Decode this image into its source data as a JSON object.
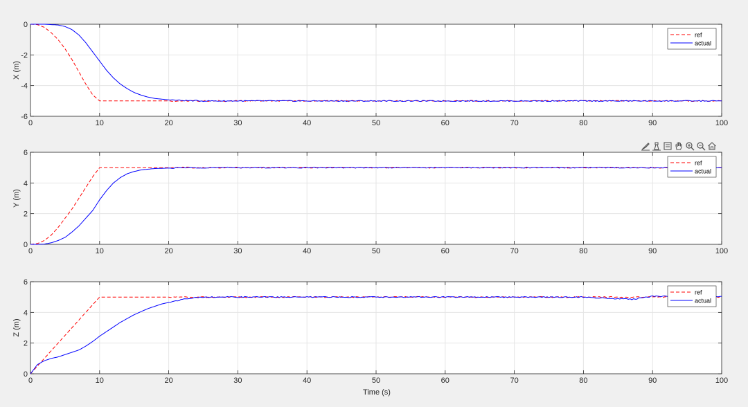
{
  "toolbar": {
    "icons": [
      "brush-icon",
      "data-tips-icon",
      "datacursor-icon",
      "pan-hand-icon",
      "zoom-in-icon",
      "zoom-out-icon",
      "home-icon"
    ]
  },
  "colors": {
    "ref": "#ff0000",
    "actual": "#0000ff",
    "grid": "#e5e5e5",
    "axis": "#262626"
  },
  "chart_data": [
    {
      "type": "line",
      "ylabel": "X (m)",
      "xlabel": "",
      "xlim": [
        0,
        100
      ],
      "ylim": [
        -6,
        0
      ],
      "xticks": [
        "0",
        "10",
        "20",
        "30",
        "40",
        "50",
        "60",
        "70",
        "80",
        "90",
        "100"
      ],
      "yticks": [
        "-6",
        "-4",
        "-2",
        "0"
      ],
      "legend": {
        "position": "top-right",
        "entries": [
          "ref",
          "actual"
        ]
      },
      "grid": true,
      "series": [
        {
          "name": "ref",
          "style": "dashed",
          "x": [
            0,
            1,
            2,
            3,
            4,
            5,
            6,
            7,
            8,
            9,
            10,
            20,
            30,
            40,
            50,
            60,
            70,
            80,
            90,
            100
          ],
          "y": [
            0,
            -0.025,
            -0.2,
            -0.55,
            -1.0,
            -1.6,
            -2.3,
            -3.1,
            -3.9,
            -4.6,
            -5.0,
            -5.0,
            -5.0,
            -5.0,
            -5.0,
            -5.0,
            -5.0,
            -5.0,
            -5.0,
            -5.0
          ]
        },
        {
          "name": "actual",
          "style": "solid",
          "x": [
            0,
            2,
            4,
            5,
            6,
            7,
            8,
            9,
            10,
            11,
            12,
            13,
            14,
            15,
            16,
            17,
            18,
            20,
            22,
            25,
            30,
            40,
            50,
            60,
            70,
            80,
            90,
            100
          ],
          "y": [
            0,
            0,
            -0.05,
            -0.15,
            -0.35,
            -0.7,
            -1.2,
            -1.8,
            -2.4,
            -3.0,
            -3.5,
            -3.9,
            -4.2,
            -4.45,
            -4.62,
            -4.75,
            -4.84,
            -4.93,
            -4.97,
            -5.0,
            -5.0,
            -5.0,
            -5.0,
            -5.0,
            -5.0,
            -5.0,
            -5.0,
            -5.0
          ]
        }
      ]
    },
    {
      "type": "line",
      "ylabel": "Y (m)",
      "xlabel": "",
      "xlim": [
        0,
        100
      ],
      "ylim": [
        0,
        6
      ],
      "xticks": [
        "0",
        "10",
        "20",
        "30",
        "40",
        "50",
        "60",
        "70",
        "80",
        "90",
        "100"
      ],
      "yticks": [
        "0",
        "2",
        "4",
        "6"
      ],
      "legend": {
        "position": "top-right",
        "entries": [
          "ref",
          "actual"
        ]
      },
      "grid": true,
      "series": [
        {
          "name": "ref",
          "style": "dashed",
          "x": [
            0,
            1,
            2,
            3,
            4,
            5,
            6,
            7,
            8,
            9,
            10,
            20,
            30,
            40,
            50,
            60,
            70,
            80,
            90,
            100
          ],
          "y": [
            0,
            0.05,
            0.25,
            0.6,
            1.1,
            1.7,
            2.3,
            3.0,
            3.7,
            4.4,
            5.0,
            5.0,
            5.0,
            5.0,
            5.0,
            5.0,
            5.0,
            5.0,
            5.0,
            5.0
          ]
        },
        {
          "name": "actual",
          "style": "solid",
          "x": [
            0,
            1,
            2,
            3,
            4,
            5,
            6,
            7,
            8,
            9,
            10,
            11,
            12,
            13,
            14,
            15,
            16,
            17,
            18,
            20,
            22,
            25,
            30,
            40,
            50,
            60,
            70,
            80,
            90,
            100
          ],
          "y": [
            0,
            0,
            0.02,
            0.1,
            0.25,
            0.45,
            0.8,
            1.2,
            1.7,
            2.2,
            2.9,
            3.5,
            4.0,
            4.35,
            4.6,
            4.75,
            4.85,
            4.9,
            4.94,
            4.97,
            4.99,
            5.0,
            5.0,
            5.0,
            5.0,
            5.0,
            5.0,
            5.0,
            5.0,
            5.0
          ]
        }
      ]
    },
    {
      "type": "line",
      "ylabel": "Z (m)",
      "xlabel": "Time (s)",
      "xlim": [
        0,
        100
      ],
      "ylim": [
        0,
        6
      ],
      "xticks": [
        "0",
        "10",
        "20",
        "30",
        "40",
        "50",
        "60",
        "70",
        "80",
        "90",
        "100"
      ],
      "yticks": [
        "0",
        "2",
        "4",
        "6"
      ],
      "legend": {
        "position": "top-right",
        "entries": [
          "ref",
          "actual"
        ]
      },
      "grid": true,
      "series": [
        {
          "name": "ref",
          "style": "dashed",
          "x": [
            0,
            10,
            20,
            30,
            40,
            50,
            60,
            70,
            80,
            90,
            100
          ],
          "y": [
            0,
            5.0,
            5.0,
            5.0,
            5.0,
            5.0,
            5.0,
            5.0,
            5.0,
            5.0,
            5.0
          ]
        },
        {
          "name": "actual",
          "style": "solid",
          "x": [
            0,
            1,
            2,
            3,
            4,
            5,
            6,
            7,
            8,
            9,
            10,
            11,
            12,
            13,
            14,
            15,
            16,
            17,
            18,
            19,
            20,
            21,
            22,
            23,
            24,
            25,
            30,
            40,
            50,
            60,
            70,
            80,
            87,
            90,
            100
          ],
          "y": [
            0,
            0.6,
            0.85,
            1.0,
            1.1,
            1.25,
            1.4,
            1.55,
            1.8,
            2.1,
            2.45,
            2.75,
            3.05,
            3.35,
            3.6,
            3.85,
            4.05,
            4.25,
            4.4,
            4.55,
            4.65,
            4.75,
            4.85,
            4.93,
            4.97,
            5.0,
            5.0,
            5.0,
            5.0,
            5.0,
            5.0,
            5.0,
            4.85,
            5.05,
            5.05
          ]
        }
      ]
    }
  ]
}
